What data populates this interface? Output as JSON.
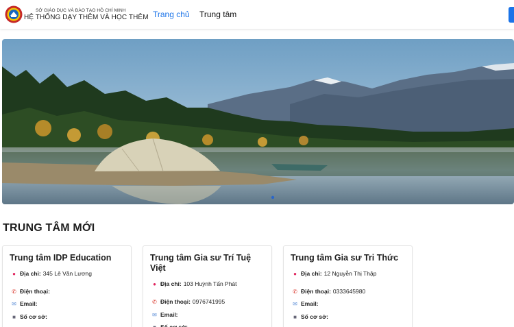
{
  "header": {
    "org_top": "SỞ GIÁO DỤC VÀ ĐÀO TẠO HỒ CHÍ MINH",
    "org_main": "HỆ THỐNG DẠY THÊM VÀ HỌC THÊM",
    "nav": {
      "home": "Trang chủ",
      "centers": "Trung tâm"
    },
    "logo_icon": "education-emblem-icon",
    "accent": "#1a73e8"
  },
  "banner": {
    "image": "lake-camping-landscape"
  },
  "section": {
    "title": "TRUNG TÂM MỚI"
  },
  "labels": {
    "address": "Địa chỉ:",
    "phone": "Điện thoại:",
    "email": "Email:",
    "facilities": "Số cơ sở:"
  },
  "cards": [
    {
      "name": "Trung tâm IDP Education",
      "address": "345 Lê Văn Lương",
      "phone": "",
      "email": "",
      "facilities": ""
    },
    {
      "name": "Trung tâm Gia sư Trí Tuệ Việt",
      "address": "103 Huỳnh Tấn Phát",
      "phone": "0976741995",
      "email": "",
      "facilities": ""
    },
    {
      "name": "Trung tâm Gia sư Tri Thức",
      "address": "12 Nguyễn Thị Thập",
      "phone": "0333645980",
      "email": "",
      "facilities": ""
    }
  ]
}
